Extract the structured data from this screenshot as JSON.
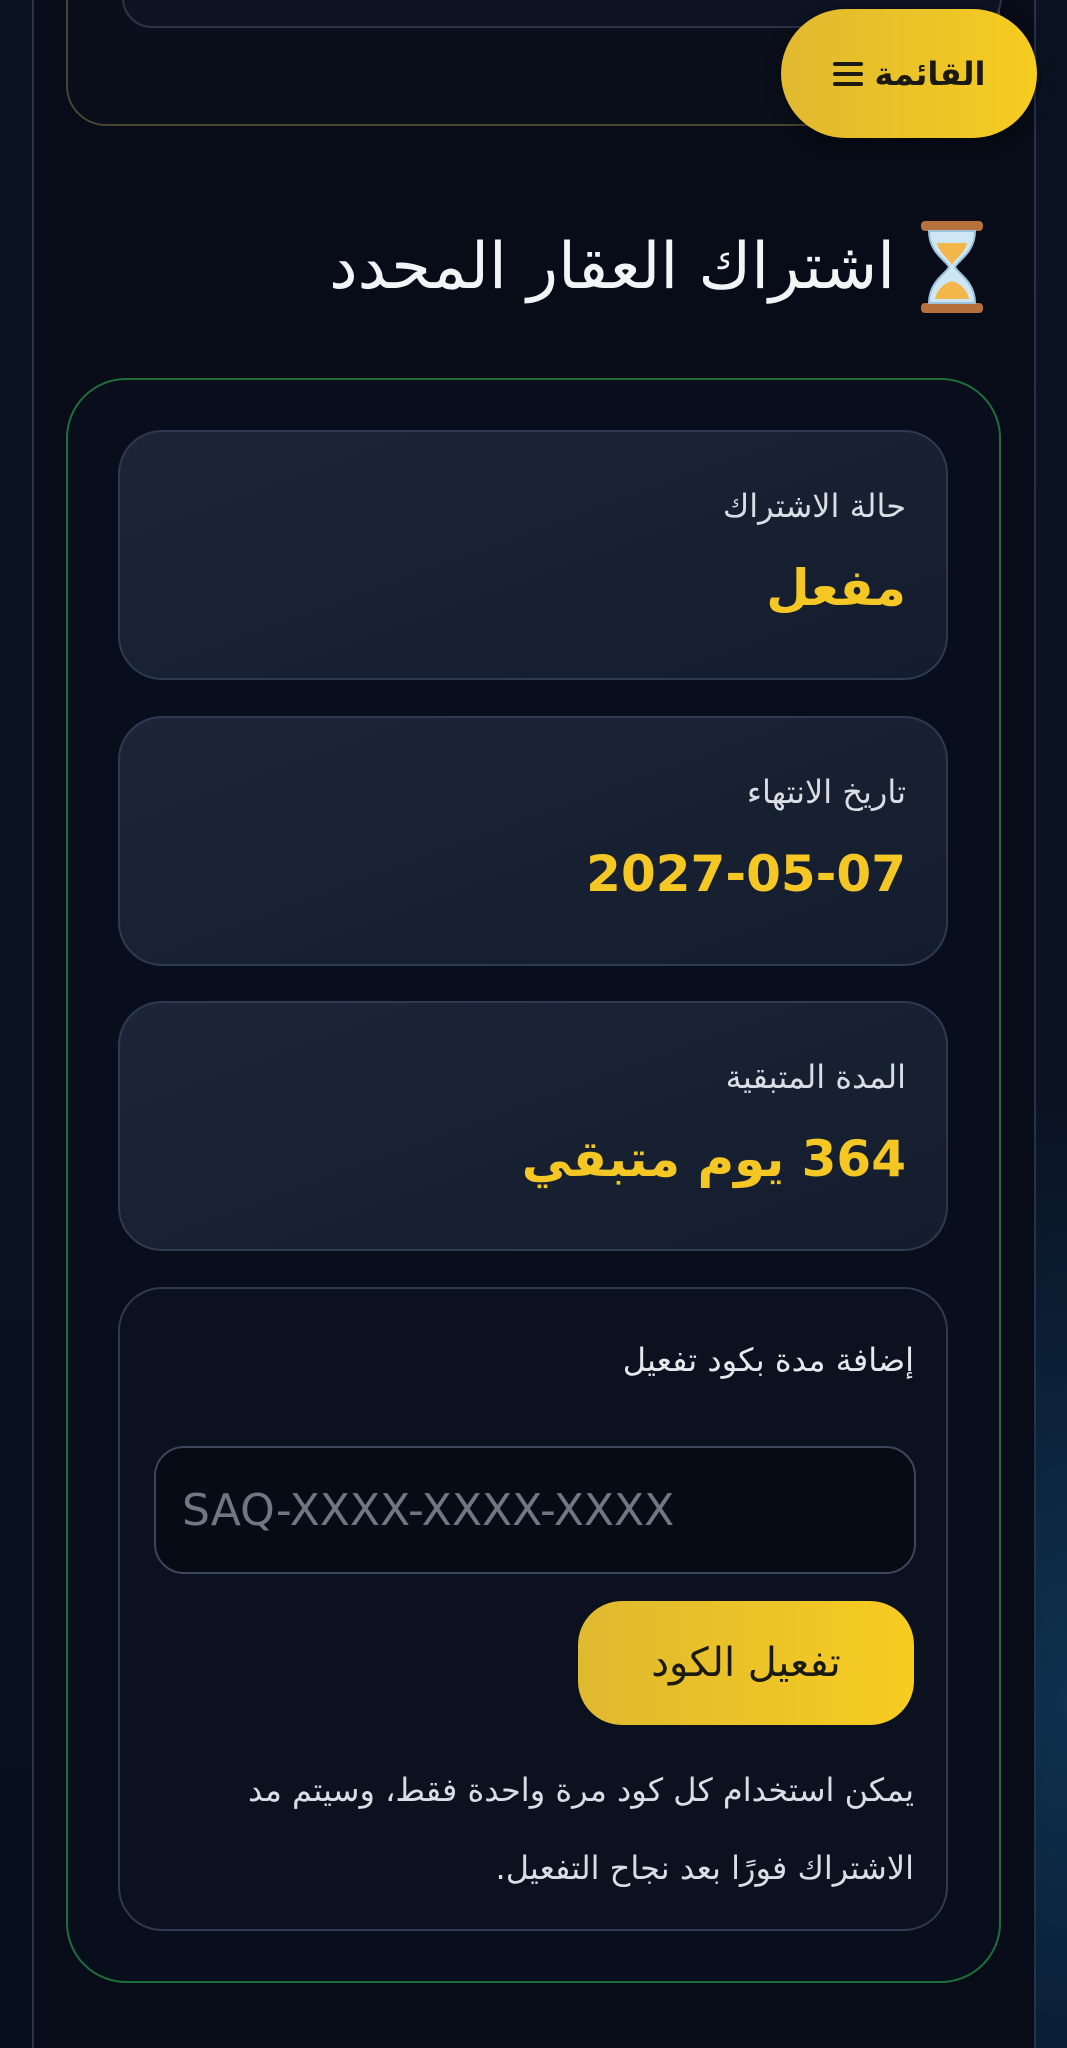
{
  "header": {
    "menu_label": "القائمة"
  },
  "section": {
    "title": "اشتراك العقار المحدد"
  },
  "subscription": {
    "status": {
      "label": "حالة الاشتراك",
      "value": "مفعل"
    },
    "expiry": {
      "label": "تاريخ الانتهاء",
      "value": "2027-05-07"
    },
    "remaining": {
      "label": "المدة المتبقية",
      "value": "364 يوم متبقي"
    }
  },
  "activation": {
    "label": "إضافة مدة بكود تفعيل",
    "input_value": "",
    "input_placeholder": "SAQ-XXXX-XXXX-XXXX",
    "button_label": "تفعيل الكود",
    "note": "يمكن استخدام كل كود مرة واحدة فقط، وسيتم مد الاشتراك فورًا بعد نجاح التفعيل."
  },
  "colors": {
    "accent": "#f4c724",
    "card_border": "#1f6e3a",
    "background": "#0a1120"
  },
  "icons": {
    "menu": "hamburger-icon",
    "section": "hourglass-icon"
  }
}
